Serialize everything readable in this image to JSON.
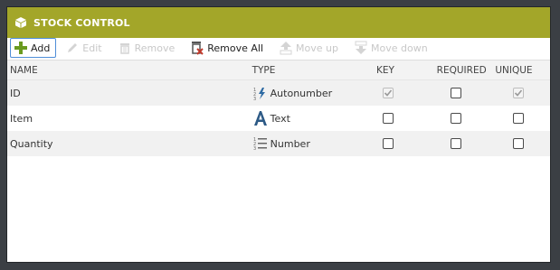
{
  "window": {
    "title": "STOCK CONTROL",
    "icon": "box-icon"
  },
  "toolbar": {
    "add": {
      "label": "Add",
      "icon": "plus-icon",
      "enabled": true
    },
    "edit": {
      "label": "Edit",
      "icon": "pencil-icon",
      "enabled": false
    },
    "remove": {
      "label": "Remove",
      "icon": "trash-icon",
      "enabled": false
    },
    "remove_all": {
      "label": "Remove All",
      "icon": "trash-x-icon",
      "enabled": true
    },
    "move_up": {
      "label": "Move up",
      "icon": "move-up-icon",
      "enabled": false
    },
    "move_down": {
      "label": "Move down",
      "icon": "move-down-icon",
      "enabled": false
    }
  },
  "columns": {
    "name": "NAME",
    "type": "TYPE",
    "key": "KEY",
    "required": "REQUIRED",
    "unique": "UNIQUE"
  },
  "rows": [
    {
      "name": "ID",
      "type": "Autonumber",
      "type_icon": "autonumber-icon",
      "key": true,
      "key_disabled": true,
      "required": false,
      "unique": true,
      "unique_disabled": true
    },
    {
      "name": "Item",
      "type": "Text",
      "type_icon": "text-type-icon",
      "key": false,
      "required": false,
      "unique": false
    },
    {
      "name": "Quantity",
      "type": "Number",
      "type_icon": "number-list-icon",
      "key": false,
      "required": false,
      "unique": false
    }
  ],
  "colors": {
    "titlebar": "#a3a629",
    "accent_blue": "#2d6aa3",
    "add_green": "#6a9a1f",
    "remove_red": "#c0392b"
  }
}
